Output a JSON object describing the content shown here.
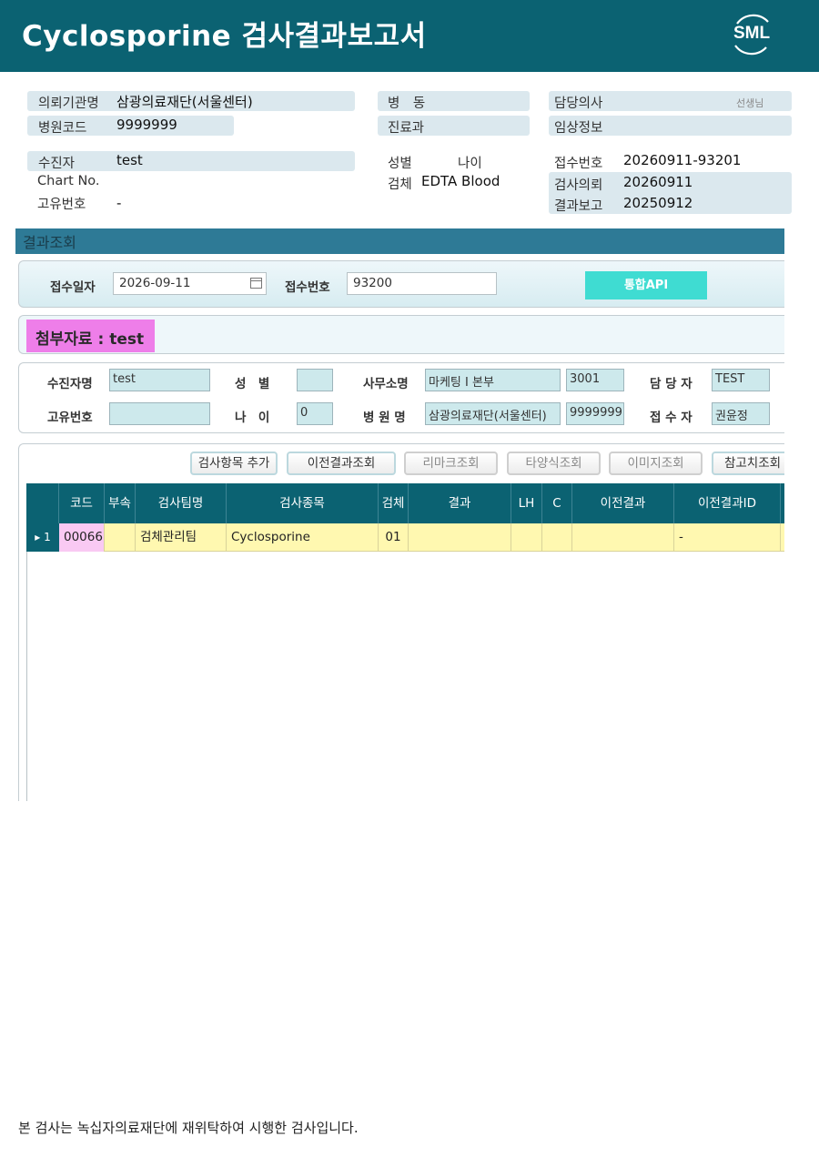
{
  "header": {
    "title": "Cyclosporine 검사결과보고서",
    "logo_text": "SML",
    "bg_color": "#0b6272"
  },
  "patient": {
    "institution_label": "의뢰기관명",
    "institution": "삼광의료재단(서울센터)",
    "hospital_code_label": "병원코드",
    "hospital_code": "9999999",
    "ward_label": "병　동",
    "department_label": "진료과",
    "doctor_label": "담당의사",
    "doctor_suffix": "선생님",
    "clinical_info_label": "임상정보",
    "patient_label": "수진자",
    "patient_name": "test",
    "chart_label": "Chart No.",
    "unique_id_label": "고유번호",
    "unique_id": "-",
    "sex_label": "성별",
    "age_label": "나이",
    "specimen_label": "검체",
    "specimen": "EDTA Blood",
    "receipt_no_label": "접수번호",
    "receipt_no": "20260911-93201",
    "request_label": "검사의뢰",
    "request_date": "20260911",
    "report_label": "결과보고",
    "report_date": "20250912"
  },
  "results": {
    "section_title": "결과조회",
    "search": {
      "date_label": "접수일자",
      "date_value": "2026-09-11",
      "receipt_label": "접수번호",
      "receipt_value": "93200",
      "api_button": "통합API"
    },
    "attachment_label": "첨부자료 : test",
    "info": {
      "name_label": "수진자명",
      "name_value": "test",
      "sex_label": "성　별",
      "sex_value": "",
      "office_label": "사무소명",
      "office_value": "마케팅 I 본부",
      "office_code": "3001",
      "manager_label": "담 당 자",
      "manager_value": "TEST",
      "uid_label": "고유번호",
      "uid_value": "",
      "age_label": "나　이",
      "age_value": "0",
      "hospital_label": "병 원 명",
      "hospital_value": "삼광의료재단(서울센터)",
      "hospital_code": "9999999",
      "receiver_label": "접 수 자",
      "receiver_value": "권윤정"
    },
    "toolbar": {
      "add_item": "검사항목 추가",
      "prev_result": "이전결과조회",
      "remark": "리마크조회",
      "other_form": "타양식조회",
      "image": "이미지조회",
      "reference": "참고치조회"
    },
    "grid": {
      "columns": [
        "코드",
        "부속",
        "검사팀명",
        "검사종목",
        "검체",
        "결과",
        "LH",
        "C",
        "이전결과",
        "이전결과ID"
      ],
      "rows": [
        {
          "index": "▸ 1",
          "code": "00066",
          "sub": "",
          "team": "검체관리팀",
          "test": "Cyclosporine",
          "specimen": "01",
          "result": "",
          "lh": "",
          "c": "",
          "prev_result": "",
          "prev_result_id": "-"
        }
      ]
    }
  },
  "footer": {
    "note": "본 검사는 녹십자의료재단에 재위탁하여 시행한 검사입니다."
  }
}
